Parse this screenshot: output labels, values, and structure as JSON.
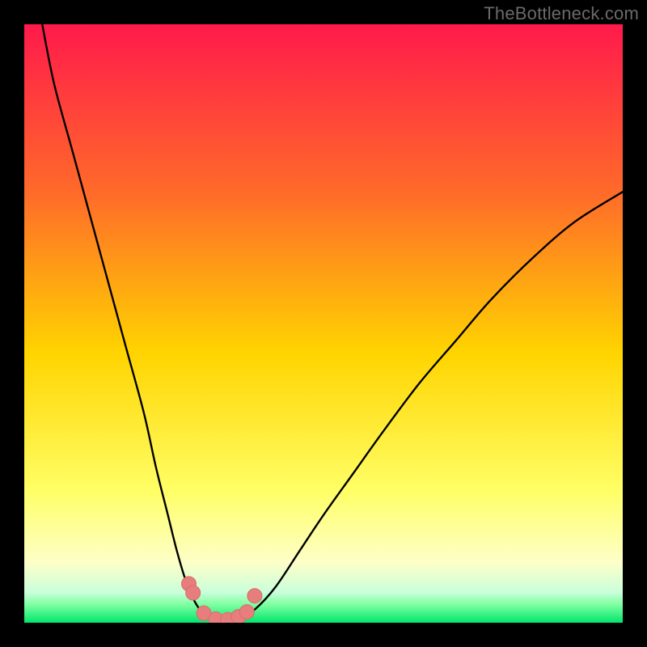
{
  "watermark": "TheBottleneck.com",
  "colors": {
    "black": "#000000",
    "curve": "#000000",
    "marker_fill": "#e77d7d",
    "marker_stroke": "#d96c6c",
    "grad_top": "#ff1a4b",
    "grad_mid1": "#ff6a2a",
    "grad_mid2": "#ffd400",
    "grad_mid3": "#ffff66",
    "grad_pale": "#fdffc8",
    "grad_green_light": "#7dffa0",
    "grad_green": "#00e66a"
  },
  "chart_data": {
    "type": "line",
    "title": "",
    "xlabel": "",
    "ylabel": "",
    "xlim": [
      0,
      100
    ],
    "ylim": [
      0,
      100
    ],
    "series": [
      {
        "name": "bottleneck-curve",
        "x": [
          3,
          5,
          8,
          11,
          14,
          17,
          20,
          22,
          24,
          25.5,
          27,
          28.5,
          30,
          32,
          34,
          36,
          38.5,
          42,
          46,
          50,
          55,
          60,
          66,
          72,
          78,
          85,
          92,
          100
        ],
        "y": [
          100,
          90,
          79,
          68,
          57,
          46,
          35,
          26,
          18,
          12,
          7,
          3.5,
          1.5,
          0.6,
          0.4,
          0.8,
          2.2,
          6,
          12,
          18,
          25,
          32,
          40,
          47,
          54,
          61,
          67,
          72
        ]
      }
    ],
    "markers": {
      "name": "highlight-points",
      "x": [
        27.5,
        28.2,
        30,
        32,
        34,
        35.8,
        37.2,
        38.5
      ],
      "y": [
        6.5,
        5.0,
        1.6,
        0.6,
        0.5,
        1.0,
        1.8,
        4.5
      ]
    },
    "annotations": []
  }
}
